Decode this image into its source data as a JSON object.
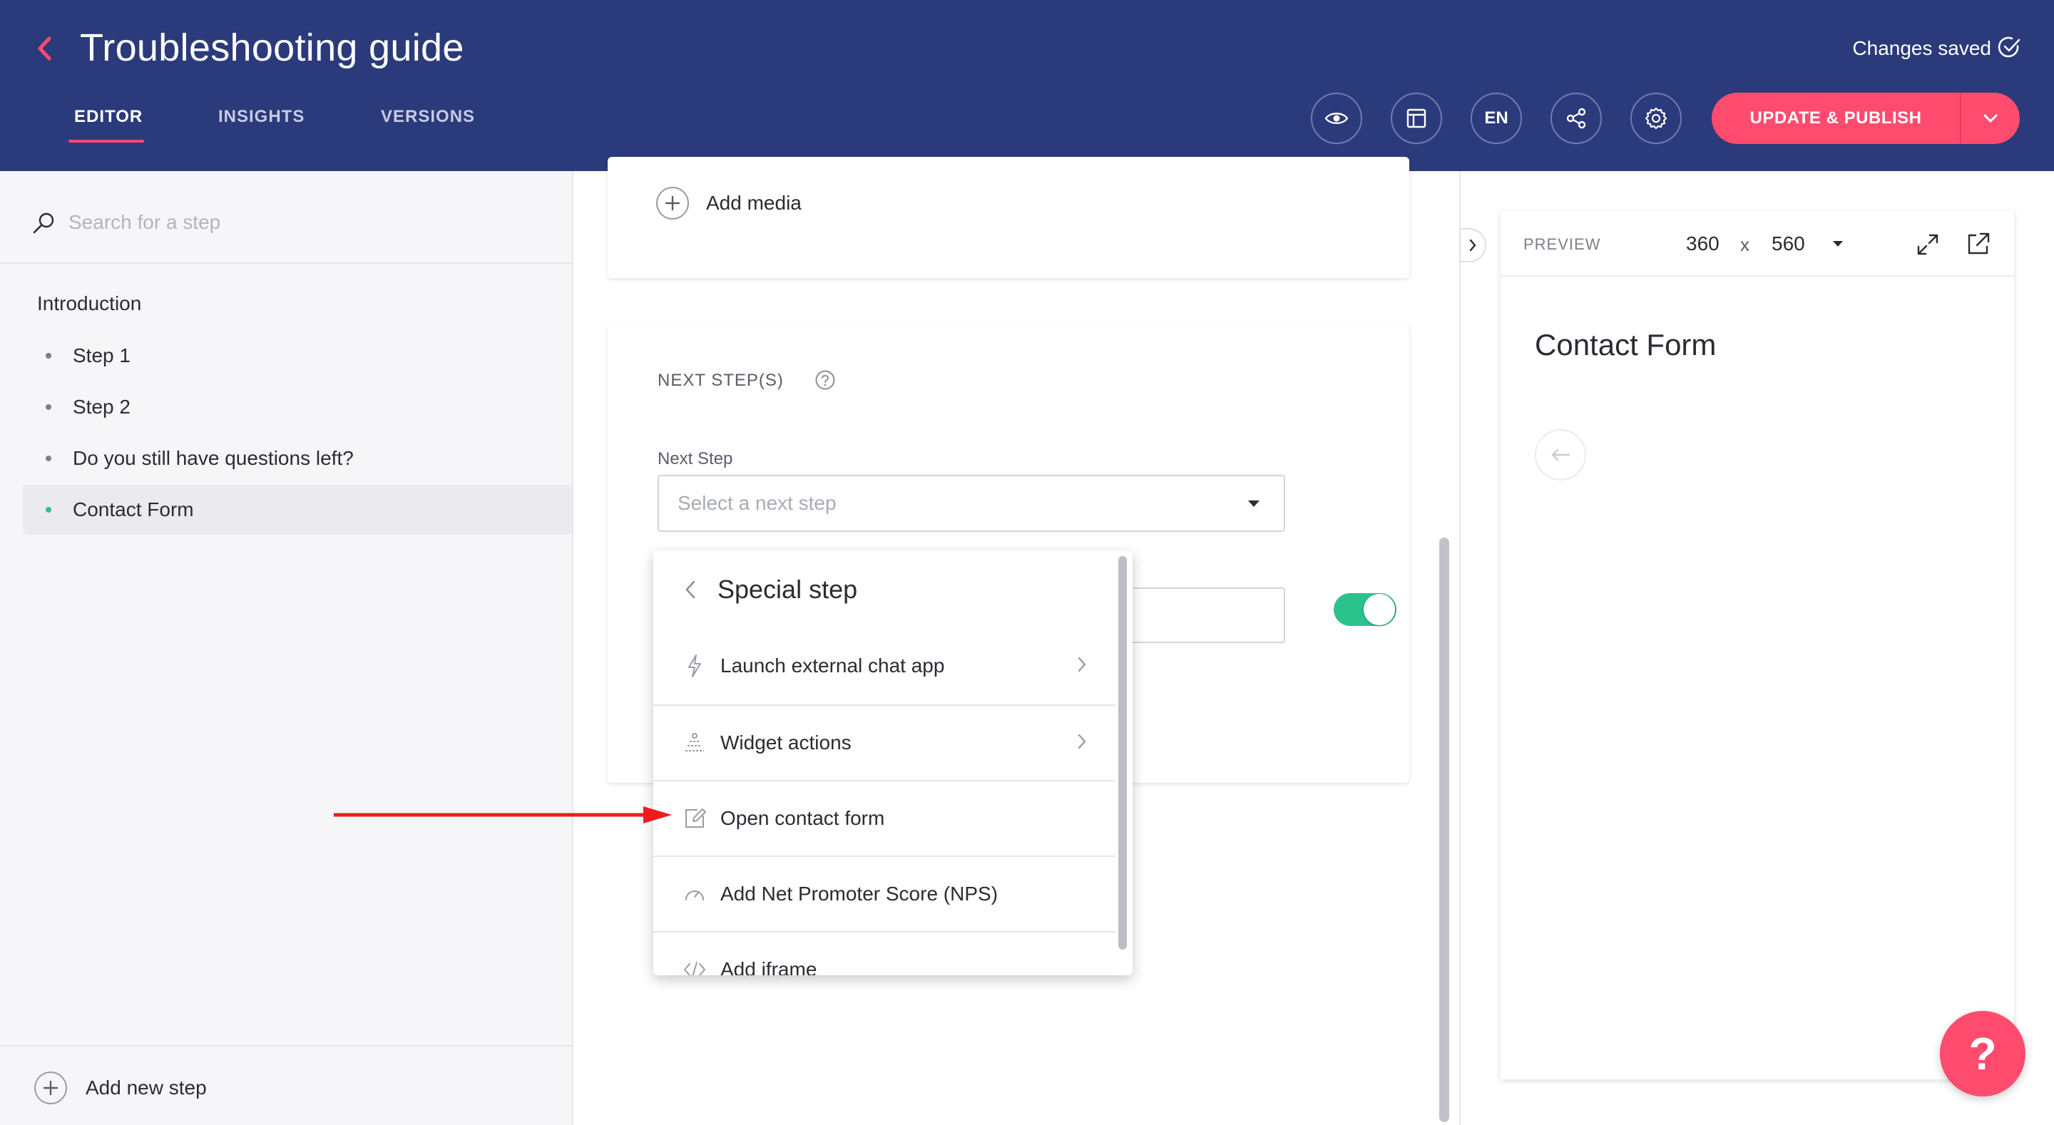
{
  "header": {
    "title": "Troubleshooting guide",
    "tabs": [
      {
        "label": "EDITOR",
        "active": true
      },
      {
        "label": "INSIGHTS",
        "active": false
      },
      {
        "label": "VERSIONS",
        "active": false
      }
    ],
    "save_status": "Changes saved",
    "language": "EN",
    "publish_label": "UPDATE & PUBLISH",
    "icons": [
      "back-chevron-icon",
      "eye-icon",
      "layout-icon",
      "share-icon",
      "gear-icon",
      "check-circle-icon",
      "chevron-down-icon"
    ],
    "colors": {
      "header_bg": "#2b3a7a",
      "accent": "#ff4b6e"
    }
  },
  "sidebar": {
    "search_placeholder": "Search for a step",
    "intro": "Introduction",
    "steps": [
      {
        "label": "Step 1",
        "active": false
      },
      {
        "label": "Step 2",
        "active": false
      },
      {
        "label": "Do you still have questions left?",
        "active": false
      },
      {
        "label": "Contact Form",
        "active": true
      }
    ],
    "add_step_label": "Add new step",
    "active_dot_color": "#2cc28c"
  },
  "editor": {
    "add_media_label": "Add media",
    "next_steps_title": "NEXT STEP(S)",
    "next_step_label": "Next Step",
    "next_step_placeholder": "Select a next step",
    "toggle_on": true,
    "toggle_color": "#2cc28c"
  },
  "dropdown": {
    "title": "Special step",
    "items": [
      {
        "label": "Launch external chat app",
        "icon": "lightning-icon",
        "has_submenu": true
      },
      {
        "label": "Widget actions",
        "icon": "widget-icon",
        "has_submenu": true
      },
      {
        "label": "Open contact form",
        "icon": "edit-form-icon",
        "has_submenu": false
      },
      {
        "label": "Add Net Promoter Score (NPS)",
        "icon": "gauge-icon",
        "has_submenu": false
      },
      {
        "label": "Add iframe",
        "icon": "code-icon",
        "has_submenu": false
      }
    ]
  },
  "preview": {
    "label": "PREVIEW",
    "width": "360",
    "separator": "x",
    "height": "560",
    "title": "Contact Form"
  },
  "help_bubble": "?"
}
